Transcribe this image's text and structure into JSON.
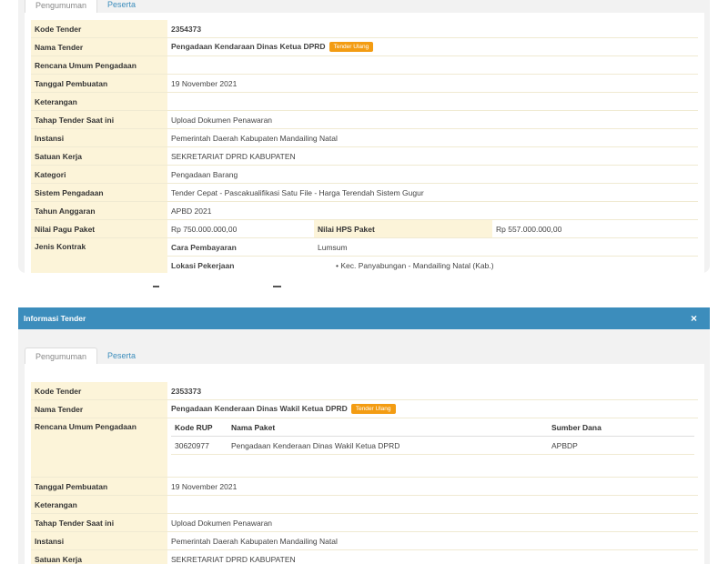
{
  "top_panel": {
    "tabs": [
      "Pengumuman",
      "Peserta"
    ],
    "labels": {
      "kode_tender": "Kode Tender",
      "nama_tender": "Nama Tender",
      "rup": "Rencana Umum Pengadaan",
      "tanggal": "Tanggal Pembuatan",
      "keterangan": "Keterangan",
      "tahap": "Tahap Tender Saat ini",
      "instansi": "Instansi",
      "satuan": "Satuan Kerja",
      "kategori": "Kategori",
      "sistem": "Sistem Pengadaan",
      "tahun": "Tahun Anggaran",
      "pagu": "Nilai Pagu Paket",
      "hps": "Nilai HPS Paket",
      "jenis_kontrak": "Jenis Kontrak",
      "cara_pembayaran": "Cara Pembayaran",
      "lokasi": "Lokasi Pekerjaan"
    },
    "values": {
      "kode_tender": "2354373",
      "nama_tender": "Pengadaan Kendaraan Dinas Ketua DPRD",
      "badge": "Tender Ulang",
      "tanggal": "19 November 2021",
      "tahap": "Upload Dokumen Penawaran",
      "instansi": "Pemerintah Daerah Kabupaten Mandailing Natal",
      "satuan": "SEKRETARIAT DPRD KABUPATEN",
      "kategori": "Pengadaan Barang",
      "sistem": "Tender Cepat - Pascakualifikasi Satu File - Harga Terendah Sistem Gugur",
      "tahun": "APBD 2021",
      "pagu": "Rp 750.000.000,00",
      "hps": "Rp 557.000.000,00",
      "cara_pembayaran": "Lumsum",
      "lokasi": "Kec. Panyabungan - Mandailing Natal (Kab.)"
    }
  },
  "dialog": {
    "title": "Informasi Tender",
    "close": "×",
    "tabs": [
      "Pengumuman",
      "Peserta"
    ],
    "labels": {
      "kode_tender": "Kode Tender",
      "nama_tender": "Nama Tender",
      "rup": "Rencana Umum Pengadaan",
      "tanggal": "Tanggal Pembuatan",
      "keterangan": "Keterangan",
      "tahap": "Tahap Tender Saat ini",
      "instansi": "Instansi",
      "satuan": "Satuan Kerja"
    },
    "values": {
      "kode_tender": "2353373",
      "nama_tender": "Pengadaan Kenderaan Dinas Wakil Ketua DPRD",
      "badge": "Tender Ulang",
      "tanggal": "19 November 2021",
      "tahap": "Upload Dokumen Penawaran",
      "instansi": "Pemerintah Daerah Kabupaten Mandailing Natal",
      "satuan": "SEKRETARIAT DPRD KABUPATEN"
    },
    "rup_table": {
      "headers": [
        "Kode RUP",
        "Nama Paket",
        "Sumber Dana"
      ],
      "row": [
        "30620977",
        "Pengadaan Kenderaan Dinas Wakil Ketua DPRD",
        "APBDP"
      ]
    }
  }
}
